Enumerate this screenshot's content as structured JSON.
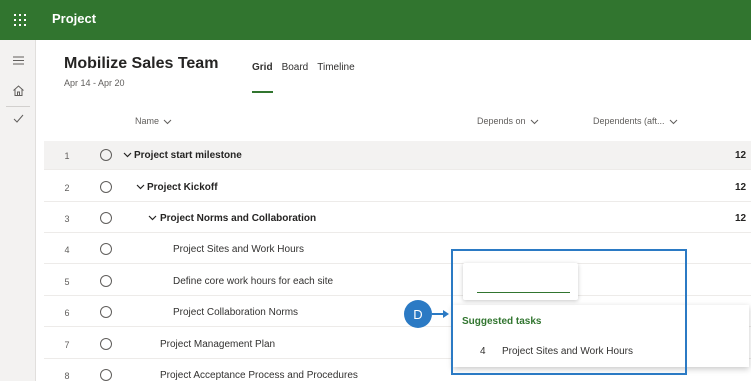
{
  "app": {
    "name": "Project"
  },
  "plan": {
    "title": "Mobilize Sales Team",
    "dates": "Apr 14 - Apr 20"
  },
  "tabs": [
    {
      "label": "Grid",
      "active": true
    },
    {
      "label": "Board",
      "active": false
    },
    {
      "label": "Timeline",
      "active": false
    }
  ],
  "columns": {
    "name": "Name",
    "depends_on": "Depends on",
    "dependents": "Dependents (aft..."
  },
  "rows": [
    {
      "num": "1",
      "name": "Project start milestone",
      "bold": true,
      "chevron": true,
      "extra": "12"
    },
    {
      "num": "2",
      "name": "Project Kickoff",
      "bold": true,
      "chevron": true,
      "extra": "12"
    },
    {
      "num": "3",
      "name": "Project Norms and Collaboration",
      "bold": true,
      "chevron": true,
      "extra": "12"
    },
    {
      "num": "4",
      "name": "Project Sites and Work Hours",
      "bold": false,
      "chevron": false,
      "extra": ""
    },
    {
      "num": "5",
      "name": "Define core work hours for each site",
      "bold": false,
      "chevron": false,
      "extra": ""
    },
    {
      "num": "6",
      "name": "Project Collaboration Norms",
      "bold": false,
      "chevron": false,
      "extra": ""
    },
    {
      "num": "7",
      "name": "Project Management Plan",
      "bold": false,
      "chevron": false,
      "extra": ""
    },
    {
      "num": "8",
      "name": "Project Acceptance Process and Procedures",
      "bold": false,
      "chevron": false,
      "extra": ""
    }
  ],
  "suggestions": {
    "title": "Suggested tasks",
    "items": [
      {
        "num": "4",
        "name": "Project Sites and Work Hours"
      }
    ]
  },
  "callout": {
    "label": "D"
  },
  "colors": {
    "brand": "#31752f",
    "callout": "#2b7ac4"
  },
  "icons": {
    "waffle": "waffle-icon",
    "menu": "hamburger-icon",
    "home": "home-icon",
    "check": "checkmark-icon",
    "chevron": "chevron-down-icon"
  }
}
